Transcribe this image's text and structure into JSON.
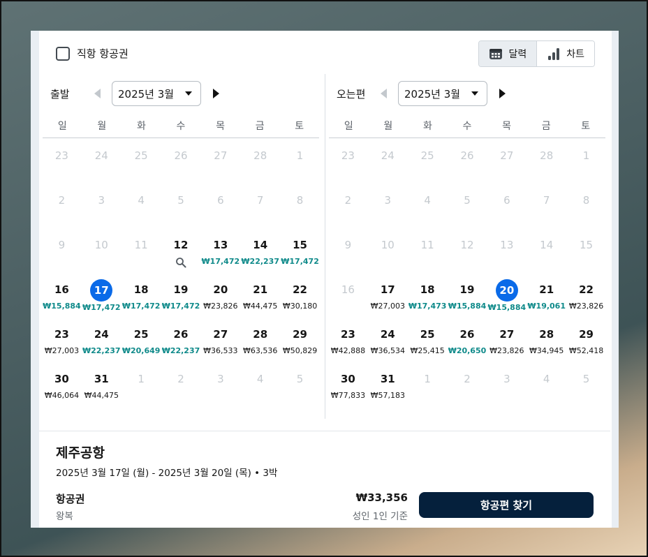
{
  "direct_only_label": "직항 항공권",
  "view_toggle": {
    "calendar": "달력",
    "chart": "차트"
  },
  "weekdays": [
    "일",
    "월",
    "화",
    "수",
    "목",
    "금",
    "토"
  ],
  "outbound": {
    "label": "출발",
    "month": "2025년 3월",
    "days": [
      {
        "d": "23",
        "m": true
      },
      {
        "d": "24",
        "m": true
      },
      {
        "d": "25",
        "m": true
      },
      {
        "d": "26",
        "m": true
      },
      {
        "d": "27",
        "m": true
      },
      {
        "d": "28",
        "m": true
      },
      {
        "d": "1",
        "m": true
      },
      {
        "d": "2",
        "m": true
      },
      {
        "d": "3",
        "m": true
      },
      {
        "d": "4",
        "m": true
      },
      {
        "d": "5",
        "m": true
      },
      {
        "d": "6",
        "m": true
      },
      {
        "d": "7",
        "m": true
      },
      {
        "d": "8",
        "m": true
      },
      {
        "d": "9",
        "m": true
      },
      {
        "d": "10",
        "m": true
      },
      {
        "d": "11",
        "m": true
      },
      {
        "d": "12",
        "search": true
      },
      {
        "d": "13",
        "p": "₩17,472",
        "c": true
      },
      {
        "d": "14",
        "p": "₩22,237",
        "c": true
      },
      {
        "d": "15",
        "p": "₩17,472",
        "c": true
      },
      {
        "d": "16",
        "p": "₩15,884",
        "c": true
      },
      {
        "d": "17",
        "p": "₩17,472",
        "c": true,
        "sel": true
      },
      {
        "d": "18",
        "p": "₩17,472",
        "c": true
      },
      {
        "d": "19",
        "p": "₩17,472",
        "c": true
      },
      {
        "d": "20",
        "p": "₩23,826"
      },
      {
        "d": "21",
        "p": "₩44,475"
      },
      {
        "d": "22",
        "p": "₩30,180"
      },
      {
        "d": "23",
        "p": "₩27,003"
      },
      {
        "d": "24",
        "p": "₩22,237",
        "c": true
      },
      {
        "d": "25",
        "p": "₩20,649",
        "c": true
      },
      {
        "d": "26",
        "p": "₩22,237",
        "c": true
      },
      {
        "d": "27",
        "p": "₩36,533"
      },
      {
        "d": "28",
        "p": "₩63,536"
      },
      {
        "d": "29",
        "p": "₩50,829"
      },
      {
        "d": "30",
        "p": "₩46,064"
      },
      {
        "d": "31",
        "p": "₩44,475"
      },
      {
        "d": "1",
        "m": true
      },
      {
        "d": "2",
        "m": true
      },
      {
        "d": "3",
        "m": true
      },
      {
        "d": "4",
        "m": true
      },
      {
        "d": "5",
        "m": true
      }
    ]
  },
  "return": {
    "label": "오는편",
    "month": "2025년 3월",
    "days": [
      {
        "d": "23",
        "m": true
      },
      {
        "d": "24",
        "m": true
      },
      {
        "d": "25",
        "m": true
      },
      {
        "d": "26",
        "m": true
      },
      {
        "d": "27",
        "m": true
      },
      {
        "d": "28",
        "m": true
      },
      {
        "d": "1",
        "m": true
      },
      {
        "d": "2",
        "m": true
      },
      {
        "d": "3",
        "m": true
      },
      {
        "d": "4",
        "m": true
      },
      {
        "d": "5",
        "m": true
      },
      {
        "d": "6",
        "m": true
      },
      {
        "d": "7",
        "m": true
      },
      {
        "d": "8",
        "m": true
      },
      {
        "d": "9",
        "m": true
      },
      {
        "d": "10",
        "m": true
      },
      {
        "d": "11",
        "m": true
      },
      {
        "d": "12",
        "m": true
      },
      {
        "d": "13",
        "m": true
      },
      {
        "d": "14",
        "m": true
      },
      {
        "d": "15",
        "m": true
      },
      {
        "d": "16",
        "m": true
      },
      {
        "d": "17",
        "p": "₩27,003"
      },
      {
        "d": "18",
        "p": "₩17,473",
        "c": true
      },
      {
        "d": "19",
        "p": "₩15,884",
        "c": true
      },
      {
        "d": "20",
        "p": "₩15,884",
        "c": true,
        "sel": true
      },
      {
        "d": "21",
        "p": "₩19,061",
        "c": true
      },
      {
        "d": "22",
        "p": "₩23,826"
      },
      {
        "d": "23",
        "p": "₩42,888"
      },
      {
        "d": "24",
        "p": "₩36,534"
      },
      {
        "d": "25",
        "p": "₩25,415"
      },
      {
        "d": "26",
        "p": "₩20,650",
        "c": true
      },
      {
        "d": "27",
        "p": "₩23,826"
      },
      {
        "d": "28",
        "p": "₩34,945"
      },
      {
        "d": "29",
        "p": "₩52,418"
      },
      {
        "d": "30",
        "p": "₩77,833"
      },
      {
        "d": "31",
        "p": "₩57,183"
      },
      {
        "d": "1",
        "m": true
      },
      {
        "d": "2",
        "m": true
      },
      {
        "d": "3",
        "m": true
      },
      {
        "d": "4",
        "m": true
      },
      {
        "d": "5",
        "m": true
      }
    ]
  },
  "summary": {
    "destination": "제주공항",
    "dates": "2025년 3월 17일 (월) - 2025년 3월 20일 (목) • 3박",
    "flight_title": "항공권",
    "flight_type": "왕복",
    "price": "₩33,356",
    "price_basis": "성인 1인 기준",
    "search_button": "항공편 찾기"
  },
  "colors": {
    "selected": "#0a6ae8",
    "cheap": "#0f8a8a",
    "button": "#05203c"
  }
}
